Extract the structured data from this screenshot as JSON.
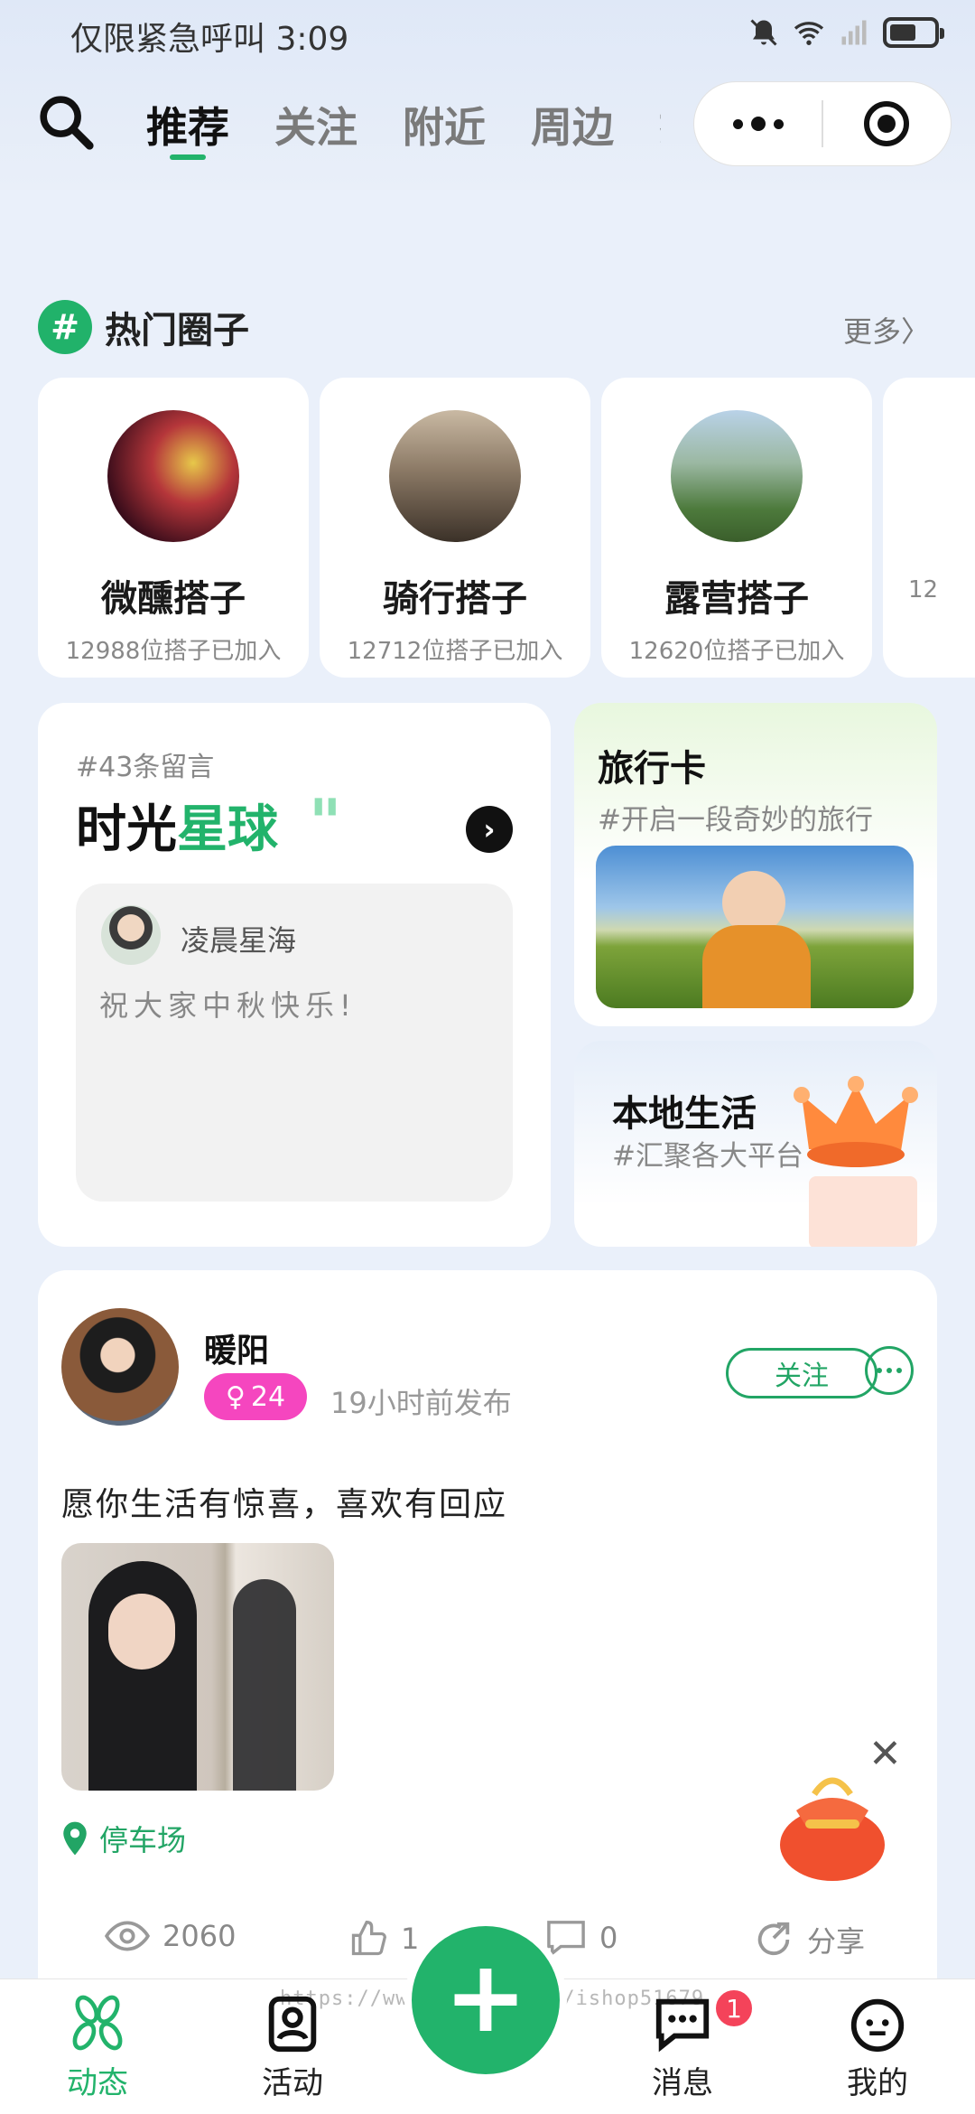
{
  "status_bar": {
    "text": "仅限紧急呼叫 3:09"
  },
  "nav": {
    "tabs": [
      {
        "label": "推荐",
        "active": true
      },
      {
        "label": "关注",
        "active": false
      },
      {
        "label": "附近",
        "active": false
      },
      {
        "label": "周边",
        "active": false
      },
      {
        "label": "搭",
        "active": false
      }
    ]
  },
  "hot_circles": {
    "title": "热门圈子",
    "more": "更多〉",
    "items": [
      {
        "name": "微醺搭子",
        "members": "12988位搭子已加入"
      },
      {
        "name": "骑行搭子",
        "members": "12712位搭子已加入"
      },
      {
        "name": "露营搭子",
        "members": "12620位搭子已加入"
      },
      {
        "name": "",
        "members": "12"
      }
    ]
  },
  "time_planet": {
    "count": "#43条留言",
    "title_a": "时光",
    "title_b": "星球",
    "quote": "\"",
    "arrow": "›",
    "user": "凌晨星海",
    "message": "祝大家中秋快乐!"
  },
  "travel_card": {
    "title": "旅行卡",
    "subtitle": "#开启一段奇妙的旅行"
  },
  "local_life": {
    "title": "本地生活",
    "subtitle": "#汇聚各大平台"
  },
  "post": {
    "author": "暖阳",
    "gender": "♀",
    "age": "24",
    "time": "19小时前发布",
    "follow": "关注",
    "text": "愿你生活有惊喜，喜欢有回应",
    "location": "停车场",
    "views": "2060",
    "likes": "1",
    "comments": "0",
    "share": "分享"
  },
  "tabbar": {
    "items": [
      "动态",
      "活动",
      "消息",
      "我的"
    ],
    "message_badge": "1",
    "watermark": "https://www.huzhan.com/ishop51679"
  },
  "colors": {
    "brand": "#22b36b",
    "badge": "#f546bf",
    "alert": "#f4435a"
  }
}
